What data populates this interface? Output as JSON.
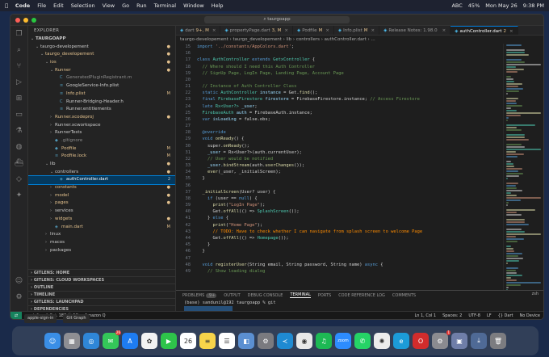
{
  "menubar": {
    "app": "Code",
    "items": [
      "File",
      "Edit",
      "Selection",
      "View",
      "Go",
      "Run",
      "Terminal",
      "Window",
      "Help"
    ],
    "status": [
      "ABC",
      "45%",
      "Mon May 26",
      "9:38 PM"
    ]
  },
  "window": {
    "search": "taurgoapp"
  },
  "explorer": {
    "title": "EXPLORER",
    "root": "TAURGOAPP",
    "rows": [
      {
        "name": "taurgo-developement",
        "indent": 1,
        "caret": "⌄",
        "icon": "",
        "color": "#cccccc",
        "badge": "●",
        "badge_color": "#e2c08d"
      },
      {
        "name": "taurgo_developement",
        "indent": 2,
        "caret": "⌄",
        "icon": "",
        "color": "#e2c08d",
        "badge": "●",
        "badge_color": "#e2c08d"
      },
      {
        "name": "ios",
        "indent": 3,
        "caret": "⌄",
        "icon": "",
        "color": "#e2c08d",
        "badge": "●",
        "badge_color": "#e2c08d"
      },
      {
        "name": "Runner",
        "indent": 4,
        "caret": "⌄",
        "icon": "",
        "color": "#e2c08d",
        "badge": "●",
        "badge_color": "#e2c08d"
      },
      {
        "name": "GeneratedPluginRegistrant.m",
        "indent": 5,
        "caret": "",
        "icon": "C",
        "color": "#8c8c8c",
        "badge": "",
        "badge_color": ""
      },
      {
        "name": "GoogleService-Info.plist",
        "indent": 5,
        "caret": "",
        "icon": "≡",
        "color": "#cccccc",
        "badge": "",
        "badge_color": ""
      },
      {
        "name": "Info.plist",
        "indent": 5,
        "caret": "",
        "icon": "≡",
        "color": "#e2c08d",
        "badge": "M",
        "badge_color": "#e2c08d"
      },
      {
        "name": "Runner-Bridging-Header.h",
        "indent": 5,
        "caret": "",
        "icon": "C",
        "color": "#cccccc",
        "badge": "",
        "badge_color": ""
      },
      {
        "name": "Runner.entitlements",
        "indent": 5,
        "caret": "",
        "icon": "≡",
        "color": "#cccccc",
        "badge": "",
        "badge_color": ""
      },
      {
        "name": "Runner.xcodeproj",
        "indent": 4,
        "caret": "›",
        "icon": "",
        "color": "#e2c08d",
        "badge": "●",
        "badge_color": "#e2c08d"
      },
      {
        "name": "Runner.xcworkspace",
        "indent": 4,
        "caret": "›",
        "icon": "",
        "color": "#cccccc",
        "badge": "",
        "badge_color": ""
      },
      {
        "name": "RunnerTests",
        "indent": 4,
        "caret": "›",
        "icon": "",
        "color": "#cccccc",
        "badge": "",
        "badge_color": ""
      },
      {
        "name": ".gitignore",
        "indent": 4,
        "caret": "",
        "icon": "◆",
        "color": "#8c8c8c",
        "badge": "",
        "badge_color": ""
      },
      {
        "name": "Podfile",
        "indent": 4,
        "caret": "",
        "icon": "◆",
        "color": "#e2c08d",
        "badge": "M",
        "badge_color": "#e2c08d"
      },
      {
        "name": "Podfile.lock",
        "indent": 4,
        "caret": "",
        "icon": "≡",
        "color": "#e2c08d",
        "badge": "M",
        "badge_color": "#e2c08d"
      },
      {
        "name": "lib",
        "indent": 3,
        "caret": "⌄",
        "icon": "",
        "color": "#cccccc",
        "badge": "●",
        "badge_color": "#e2c08d"
      },
      {
        "name": "controllers",
        "indent": 4,
        "caret": "⌄",
        "icon": "",
        "color": "#cccccc",
        "badge": "●",
        "badge_color": "#e2c08d"
      },
      {
        "name": "authController.dart",
        "indent": 5,
        "caret": "",
        "icon": "◈",
        "color": "#ffffff",
        "badge": "2",
        "badge_color": "#cccccc",
        "selected": true
      },
      {
        "name": "constants",
        "indent": 4,
        "caret": "›",
        "icon": "",
        "color": "#e2c08d",
        "badge": "●",
        "badge_color": "#e2c08d"
      },
      {
        "name": "model",
        "indent": 4,
        "caret": "›",
        "icon": "",
        "color": "#e2c08d",
        "badge": "●",
        "badge_color": "#e2c08d"
      },
      {
        "name": "pages",
        "indent": 4,
        "caret": "›",
        "icon": "",
        "color": "#e2c08d",
        "badge": "●",
        "badge_color": "#e2c08d"
      },
      {
        "name": "services",
        "indent": 4,
        "caret": "›",
        "icon": "",
        "color": "#cccccc",
        "badge": "",
        "badge_color": ""
      },
      {
        "name": "widgets",
        "indent": 4,
        "caret": "›",
        "icon": "",
        "color": "#e2c08d",
        "badge": "●",
        "badge_color": "#e2c08d"
      },
      {
        "name": "main.dart",
        "indent": 4,
        "caret": "",
        "icon": "◈",
        "color": "#e2c08d",
        "badge": "M",
        "badge_color": "#e2c08d"
      },
      {
        "name": "linux",
        "indent": 3,
        "caret": "›",
        "icon": "",
        "color": "#cccccc",
        "badge": "",
        "badge_color": ""
      },
      {
        "name": "macos",
        "indent": 3,
        "caret": "›",
        "icon": "",
        "color": "#cccccc",
        "badge": "",
        "badge_color": ""
      },
      {
        "name": "packages",
        "indent": 3,
        "caret": "›",
        "icon": "",
        "color": "#cccccc",
        "badge": "",
        "badge_color": ""
      }
    ],
    "panels": [
      "GITLENS: HOME",
      "GITLENS: CLOUD WORKSPACES",
      "OUTLINE",
      "TIMELINE",
      "GITLENS: LAUNCHPAD",
      "DEPENDENCIES"
    ]
  },
  "tabs": [
    {
      "label": "dart",
      "badge": "9+, M",
      "active": false
    },
    {
      "label": "propertyPage.dart",
      "badge": "3, M",
      "active": false
    },
    {
      "label": "Podfile",
      "badge": "M",
      "active": false
    },
    {
      "label": "Info.plist",
      "badge": "M",
      "active": false
    },
    {
      "label": "Release Notes: 1.98.0",
      "badge": "",
      "active": false
    },
    {
      "label": "authController.dart",
      "badge": "2",
      "active": true
    }
  ],
  "breadcrumb": "taurgo-developement › taurgo_developement › lib › controllers › authController.dart › ...",
  "code": [
    {
      "n": 15,
      "segs": [
        [
          "import ",
          "kw"
        ],
        [
          "'../constants/AppColors.dart'",
          "str"
        ],
        [
          ";",
          "tx"
        ]
      ]
    },
    {
      "n": 16,
      "segs": []
    },
    {
      "n": 17,
      "segs": [
        [
          "class ",
          "kw"
        ],
        [
          "AuthController ",
          "cls"
        ],
        [
          "extends ",
          "kw"
        ],
        [
          "GetxController ",
          "cls"
        ],
        [
          "{",
          "tx"
        ]
      ]
    },
    {
      "n": 18,
      "segs": [
        [
          "  // Where should I need this Auth Controller",
          "cm"
        ]
      ]
    },
    {
      "n": 19,
      "segs": [
        [
          "  // SignUp Page, LogIn Page, Landing Page, Account Page",
          "cm"
        ]
      ]
    },
    {
      "n": 20,
      "segs": []
    },
    {
      "n": 21,
      "segs": [
        [
          "  // Instance of Auth Controller Class",
          "cm"
        ]
      ]
    },
    {
      "n": 22,
      "segs": [
        [
          "  static ",
          "kw"
        ],
        [
          "AuthController ",
          "cls"
        ],
        [
          "instance ",
          "var"
        ],
        [
          "= Get.",
          "tx"
        ],
        [
          "find",
          "fn"
        ],
        [
          "();",
          "tx"
        ]
      ]
    },
    {
      "n": 23,
      "segs": [
        [
          "  final ",
          "kw"
        ],
        [
          "FirebaseFirestore ",
          "cls"
        ],
        [
          "firestore ",
          "var"
        ],
        [
          "= FirebaseFirestore.instance; ",
          "tx"
        ],
        [
          "// Access Firestore",
          "cm"
        ]
      ]
    },
    {
      "n": 24,
      "segs": [
        [
          "  late ",
          "kw"
        ],
        [
          "Rx<User?> ",
          "cls"
        ],
        [
          "_user",
          "var"
        ],
        [
          ";",
          "tx"
        ]
      ]
    },
    {
      "n": 25,
      "segs": [
        [
          "  FirebaseAuth ",
          "cls"
        ],
        [
          "auth ",
          "var"
        ],
        [
          "= FirebaseAuth.instance;",
          "tx"
        ]
      ]
    },
    {
      "n": 26,
      "segs": [
        [
          "  var ",
          "kw"
        ],
        [
          "isLoading ",
          "var"
        ],
        [
          "= false.obs;",
          "tx"
        ]
      ]
    },
    {
      "n": 27,
      "segs": []
    },
    {
      "n": 28,
      "segs": [
        [
          "  @override",
          "kw"
        ]
      ]
    },
    {
      "n": 29,
      "segs": [
        [
          "  void ",
          "kw"
        ],
        [
          "onReady",
          "fn"
        ],
        [
          "() {",
          "tx"
        ]
      ]
    },
    {
      "n": 30,
      "segs": [
        [
          "    super.",
          "tx"
        ],
        [
          "onReady",
          "fn"
        ],
        [
          "();",
          "tx"
        ]
      ]
    },
    {
      "n": 31,
      "segs": [
        [
          "    _user ",
          "var"
        ],
        [
          "= Rx<User?>(auth.currentUser);",
          "tx"
        ]
      ]
    },
    {
      "n": 32,
      "segs": [
        [
          "    // User would be notified",
          "cm"
        ]
      ]
    },
    {
      "n": 33,
      "segs": [
        [
          "    _user.",
          "var"
        ],
        [
          "bindStream",
          "fn"
        ],
        [
          "(auth.",
          "tx"
        ],
        [
          "userChanges",
          "fn"
        ],
        [
          "());",
          "tx"
        ]
      ]
    },
    {
      "n": 34,
      "segs": [
        [
          "    ever",
          "fn"
        ],
        [
          "(_user, _initialScreen);",
          "tx"
        ]
      ]
    },
    {
      "n": 35,
      "segs": [
        [
          "  }",
          "tx"
        ]
      ]
    },
    {
      "n": 36,
      "segs": []
    },
    {
      "n": 37,
      "segs": [
        [
          "  _initialScreen",
          "fn"
        ],
        [
          "(User? user) {",
          "tx"
        ]
      ]
    },
    {
      "n": 38,
      "segs": [
        [
          "    if ",
          "kw"
        ],
        [
          "(user == ",
          "tx"
        ],
        [
          "null",
          "kw"
        ],
        [
          ") {",
          "tx"
        ]
      ]
    },
    {
      "n": 39,
      "segs": [
        [
          "      print",
          "fn"
        ],
        [
          "(",
          "tx"
        ],
        [
          "\"LogIn Page\"",
          "str"
        ],
        [
          ");",
          "tx"
        ]
      ]
    },
    {
      "n": 40,
      "segs": [
        [
          "      Get.",
          "tx"
        ],
        [
          "offAll",
          "fn"
        ],
        [
          "(() => ",
          "tx"
        ],
        [
          "SplashScreen",
          "cls"
        ],
        [
          "());",
          "tx"
        ]
      ]
    },
    {
      "n": 41,
      "segs": [
        [
          "    } ",
          "tx"
        ],
        [
          "else ",
          "kw"
        ],
        [
          "{",
          "tx"
        ]
      ]
    },
    {
      "n": 42,
      "segs": [
        [
          "      print",
          "fn"
        ],
        [
          "(",
          "tx"
        ],
        [
          "\"Home Page\"",
          "str"
        ],
        [
          ");",
          "tx"
        ]
      ]
    },
    {
      "n": 43,
      "segs": [
        [
          "      // TODO: Have to check whether I can navigate from splash screen to welcome Page",
          "todo"
        ]
      ]
    },
    {
      "n": 44,
      "segs": [
        [
          "      Get.",
          "tx"
        ],
        [
          "offAll",
          "fn"
        ],
        [
          "(() => ",
          "tx"
        ],
        [
          "Homepage",
          "cls"
        ],
        [
          "());",
          "tx"
        ]
      ]
    },
    {
      "n": 45,
      "segs": [
        [
          "    }",
          "tx"
        ]
      ]
    },
    {
      "n": 46,
      "segs": [
        [
          "  }",
          "tx"
        ]
      ]
    },
    {
      "n": 47,
      "segs": []
    },
    {
      "n": 48,
      "segs": [
        [
          "  void ",
          "kw"
        ],
        [
          "registerUser",
          "fn"
        ],
        [
          "(String email, String password, String name) ",
          "tx"
        ],
        [
          "async ",
          "kw"
        ],
        [
          "{",
          "tx"
        ]
      ]
    },
    {
      "n": 49,
      "segs": [
        [
          "    // Show loading dialog",
          "cm"
        ]
      ]
    }
  ],
  "terminal": {
    "tabs": [
      {
        "label": "PROBLEMS",
        "badge": "9+",
        "on": false
      },
      {
        "label": "OUTPUT",
        "badge": "",
        "on": false
      },
      {
        "label": "DEBUG CONSOLE",
        "badge": "",
        "on": false
      },
      {
        "label": "TERMINAL",
        "badge": "",
        "on": true
      },
      {
        "label": "PORTS",
        "badge": "",
        "on": false
      },
      {
        "label": "CODE REFERENCE LOG",
        "badge": "",
        "on": false
      },
      {
        "label": "COMMENTS",
        "badge": "",
        "on": false
      }
    ],
    "shell": "zsh",
    "lines": [
      "(base) sandunil@192 taurgoapp % git",
      "",
      "(base) sandunil@192 taurgoapp % "
    ]
  },
  "statusbar": {
    "left": [
      "main*",
      "⊗ 0 ⚠ 183 ⓘ 1K",
      "Amazon Q"
    ],
    "right": [
      "Ln 1, Col 1",
      "Spaces: 2",
      "UTF-8",
      "LF",
      "{} Dart",
      "No Device"
    ]
  },
  "taskbar": [
    "apple-sign-in",
    "Git Graph"
  ],
  "dock": [
    {
      "name": "finder",
      "glyph": "☺",
      "bg": "#3a8ee6",
      "badge": ""
    },
    {
      "name": "launchpad",
      "glyph": "▦",
      "bg": "#8e8e93",
      "badge": ""
    },
    {
      "name": "safari",
      "glyph": "◎",
      "bg": "#2f86d8",
      "badge": ""
    },
    {
      "name": "messages",
      "glyph": "✉",
      "bg": "#34c759",
      "badge": "26"
    },
    {
      "name": "app-store",
      "glyph": "A",
      "bg": "#1e7cf2",
      "badge": ""
    },
    {
      "name": "photos",
      "glyph": "✿",
      "bg": "#f2f2f2",
      "badge": ""
    },
    {
      "name": "facetime",
      "glyph": "▶",
      "bg": "#2ec44a",
      "badge": ""
    },
    {
      "name": "calendar",
      "glyph": "26",
      "bg": "#ffffff",
      "badge": ""
    },
    {
      "name": "notes",
      "glyph": "≡",
      "bg": "#f7d44a",
      "badge": ""
    },
    {
      "name": "reminders",
      "glyph": "☰",
      "bg": "#ffffff",
      "badge": ""
    },
    {
      "name": "preview",
      "glyph": "◧",
      "bg": "#5b8fd1",
      "badge": ""
    },
    {
      "name": "settings",
      "glyph": "⚙",
      "bg": "#7a7a7f",
      "badge": ""
    },
    {
      "name": "vscode",
      "glyph": "≺",
      "bg": "#1f8ad2",
      "badge": ""
    },
    {
      "name": "chrome",
      "glyph": "◉",
      "bg": "#e8e8e8",
      "badge": ""
    },
    {
      "name": "spotify",
      "glyph": "♫",
      "bg": "#1db954",
      "badge": ""
    },
    {
      "name": "zoom",
      "glyph": "zoom",
      "bg": "#2d8cff",
      "badge": ""
    },
    {
      "name": "whatsapp",
      "glyph": "✆",
      "bg": "#25d366",
      "badge": ""
    },
    {
      "name": "chatgpt",
      "glyph": "✺",
      "bg": "#ececec",
      "badge": ""
    },
    {
      "name": "edge",
      "glyph": "e",
      "bg": "#1c9bd8",
      "badge": ""
    },
    {
      "name": "opera",
      "glyph": "O",
      "bg": "#d12c2c",
      "badge": ""
    },
    {
      "name": "system-preferences",
      "glyph": "⚙",
      "bg": "#8b8b90",
      "badge": "1"
    },
    {
      "name": "disk-utility",
      "glyph": "▣",
      "bg": "#6f7ea8",
      "badge": ""
    },
    {
      "name": "downloads",
      "glyph": "⤓",
      "bg": "#4f6a96",
      "badge": ""
    },
    {
      "name": "trash",
      "glyph": "🗑",
      "bg": "#7c7c80",
      "badge": ""
    }
  ]
}
